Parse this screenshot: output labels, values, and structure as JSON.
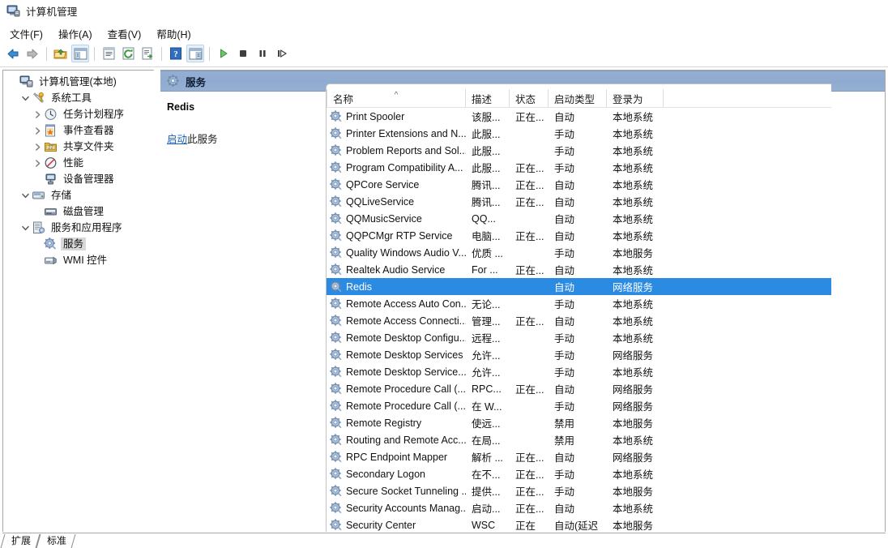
{
  "window": {
    "title": "计算机管理",
    "icon": "computer-management-icon"
  },
  "menubar": {
    "items": [
      {
        "label": "文件(F)",
        "name": "menu-file"
      },
      {
        "label": "操作(A)",
        "name": "menu-action"
      },
      {
        "label": "查看(V)",
        "name": "menu-view"
      },
      {
        "label": "帮助(H)",
        "name": "menu-help"
      }
    ]
  },
  "toolbar": {
    "buttons": [
      {
        "name": "back-icon",
        "glyph": "back"
      },
      {
        "name": "forward-icon",
        "glyph": "forward"
      },
      {
        "name": "up-folder-icon",
        "glyph": "folder-up"
      },
      {
        "name": "show-hide-console-tree-icon",
        "glyph": "console-tree"
      },
      {
        "name": "properties-icon",
        "glyph": "properties"
      },
      {
        "name": "refresh-icon",
        "glyph": "refresh"
      },
      {
        "name": "export-list-icon",
        "glyph": "export"
      },
      {
        "name": "help-icon",
        "glyph": "help"
      },
      {
        "name": "show-action-pane-icon",
        "glyph": "action-pane"
      },
      {
        "name": "start-service-icon",
        "glyph": "play"
      },
      {
        "name": "stop-service-icon",
        "glyph": "stop"
      },
      {
        "name": "pause-service-icon",
        "glyph": "pause"
      },
      {
        "name": "restart-service-icon",
        "glyph": "restart"
      }
    ]
  },
  "tree": {
    "nodes": [
      {
        "label": "计算机管理(本地)",
        "indent": 0,
        "twisty": "",
        "icon": "computer-icon",
        "name": "tree-node-computer-management",
        "selected": false
      },
      {
        "label": "系统工具",
        "indent": 1,
        "twisty": "v",
        "icon": "system-tools-icon",
        "name": "tree-node-system-tools",
        "selected": false
      },
      {
        "label": "任务计划程序",
        "indent": 2,
        "twisty": ">",
        "icon": "task-scheduler-icon",
        "name": "tree-node-task-scheduler",
        "selected": false
      },
      {
        "label": "事件查看器",
        "indent": 2,
        "twisty": ">",
        "icon": "event-viewer-icon",
        "name": "tree-node-event-viewer",
        "selected": false
      },
      {
        "label": "共享文件夹",
        "indent": 2,
        "twisty": ">",
        "icon": "shared-folders-icon",
        "name": "tree-node-shared-folders",
        "selected": false
      },
      {
        "label": "性能",
        "indent": 2,
        "twisty": ">",
        "icon": "performance-icon",
        "name": "tree-node-performance",
        "selected": false
      },
      {
        "label": "设备管理器",
        "indent": 2,
        "twisty": "",
        "icon": "device-manager-icon",
        "name": "tree-node-device-manager",
        "selected": false
      },
      {
        "label": "存储",
        "indent": 1,
        "twisty": "v",
        "icon": "storage-icon",
        "name": "tree-node-storage",
        "selected": false
      },
      {
        "label": "磁盘管理",
        "indent": 2,
        "twisty": "",
        "icon": "disk-management-icon",
        "name": "tree-node-disk-management",
        "selected": false
      },
      {
        "label": "服务和应用程序",
        "indent": 1,
        "twisty": "v",
        "icon": "services-apps-icon",
        "name": "tree-node-services-and-apps",
        "selected": false
      },
      {
        "label": "服务",
        "indent": 2,
        "twisty": "",
        "icon": "service-gear-icon",
        "name": "tree-node-services",
        "selected": true
      },
      {
        "label": "WMI 控件",
        "indent": 2,
        "twisty": "",
        "icon": "wmi-control-icon",
        "name": "tree-node-wmi-control",
        "selected": false
      }
    ]
  },
  "band": {
    "title": "服务",
    "icon": "service-gear-icon"
  },
  "details": {
    "service_name": "Redis",
    "action_link": "启动",
    "action_suffix": "此服务"
  },
  "list": {
    "columns": [
      {
        "label": "名称",
        "name": "column-header-name",
        "sorted": true
      },
      {
        "label": "描述",
        "name": "column-header-description",
        "sorted": false
      },
      {
        "label": "状态",
        "name": "column-header-status",
        "sorted": false
      },
      {
        "label": "启动类型",
        "name": "column-header-startup-type",
        "sorted": false
      },
      {
        "label": "登录为",
        "name": "column-header-log-on-as",
        "sorted": false
      }
    ],
    "sort_indicator": "^",
    "rows": [
      {
        "name": "Print Spooler",
        "desc": "该服...",
        "status": "正在...",
        "startup": "自动",
        "logon": "本地系统",
        "selected": false
      },
      {
        "name": "Printer Extensions and N...",
        "desc": "此服...",
        "status": "",
        "startup": "手动",
        "logon": "本地系统",
        "selected": false
      },
      {
        "name": "Problem Reports and Sol...",
        "desc": "此服...",
        "status": "",
        "startup": "手动",
        "logon": "本地系统",
        "selected": false
      },
      {
        "name": "Program Compatibility A...",
        "desc": "此服...",
        "status": "正在...",
        "startup": "手动",
        "logon": "本地系统",
        "selected": false
      },
      {
        "name": "QPCore Service",
        "desc": "腾讯...",
        "status": "正在...",
        "startup": "自动",
        "logon": "本地系统",
        "selected": false
      },
      {
        "name": "QQLiveService",
        "desc": "腾讯...",
        "status": "正在...",
        "startup": "自动",
        "logon": "本地系统",
        "selected": false
      },
      {
        "name": "QQMusicService",
        "desc": "QQ...",
        "status": "",
        "startup": "自动",
        "logon": "本地系统",
        "selected": false
      },
      {
        "name": "QQPCMgr RTP Service",
        "desc": "电脑...",
        "status": "正在...",
        "startup": "自动",
        "logon": "本地系统",
        "selected": false
      },
      {
        "name": "Quality Windows Audio V...",
        "desc": "优质 ...",
        "status": "",
        "startup": "手动",
        "logon": "本地服务",
        "selected": false
      },
      {
        "name": "Realtek Audio Service",
        "desc": "For ...",
        "status": "正在...",
        "startup": "自动",
        "logon": "本地系统",
        "selected": false
      },
      {
        "name": "Redis",
        "desc": "",
        "status": "",
        "startup": "自动",
        "logon": "网络服务",
        "selected": true
      },
      {
        "name": "Remote Access Auto Con...",
        "desc": "无论...",
        "status": "",
        "startup": "手动",
        "logon": "本地系统",
        "selected": false
      },
      {
        "name": "Remote Access Connecti...",
        "desc": "管理...",
        "status": "正在...",
        "startup": "自动",
        "logon": "本地系统",
        "selected": false
      },
      {
        "name": "Remote Desktop Configu...",
        "desc": "远程...",
        "status": "",
        "startup": "手动",
        "logon": "本地系统",
        "selected": false
      },
      {
        "name": "Remote Desktop Services",
        "desc": "允许...",
        "status": "",
        "startup": "手动",
        "logon": "网络服务",
        "selected": false
      },
      {
        "name": "Remote Desktop Service...",
        "desc": "允许...",
        "status": "",
        "startup": "手动",
        "logon": "本地系统",
        "selected": false
      },
      {
        "name": "Remote Procedure Call (...",
        "desc": "RPC...",
        "status": "正在...",
        "startup": "自动",
        "logon": "网络服务",
        "selected": false
      },
      {
        "name": "Remote Procedure Call (...",
        "desc": "在 W...",
        "status": "",
        "startup": "手动",
        "logon": "网络服务",
        "selected": false
      },
      {
        "name": "Remote Registry",
        "desc": "使远...",
        "status": "",
        "startup": "禁用",
        "logon": "本地服务",
        "selected": false
      },
      {
        "name": "Routing and Remote Acc...",
        "desc": "在局...",
        "status": "",
        "startup": "禁用",
        "logon": "本地系统",
        "selected": false
      },
      {
        "name": "RPC Endpoint Mapper",
        "desc": "解析 ...",
        "status": "正在...",
        "startup": "自动",
        "logon": "网络服务",
        "selected": false
      },
      {
        "name": "Secondary Logon",
        "desc": "在不...",
        "status": "正在...",
        "startup": "手动",
        "logon": "本地系统",
        "selected": false
      },
      {
        "name": "Secure Socket Tunneling ...",
        "desc": "提供...",
        "status": "正在...",
        "startup": "手动",
        "logon": "本地服务",
        "selected": false
      },
      {
        "name": "Security Accounts Manag...",
        "desc": "启动...",
        "status": "正在...",
        "startup": "自动",
        "logon": "本地系统",
        "selected": false
      },
      {
        "name": "Security Center",
        "desc": "WSC",
        "status": "正在",
        "startup": "自动(延迟",
        "logon": "本地服务",
        "selected": false
      }
    ]
  },
  "footer": {
    "tabs": [
      {
        "label": "扩展",
        "name": "tab-extended"
      },
      {
        "label": "标准",
        "name": "tab-standard"
      }
    ]
  },
  "colors": {
    "selection_blue": "#2b8ae2",
    "band_blue": "#8fabd0",
    "link_blue": "#1c5fb5",
    "tree_selection_gray": "#d8d8d8"
  }
}
